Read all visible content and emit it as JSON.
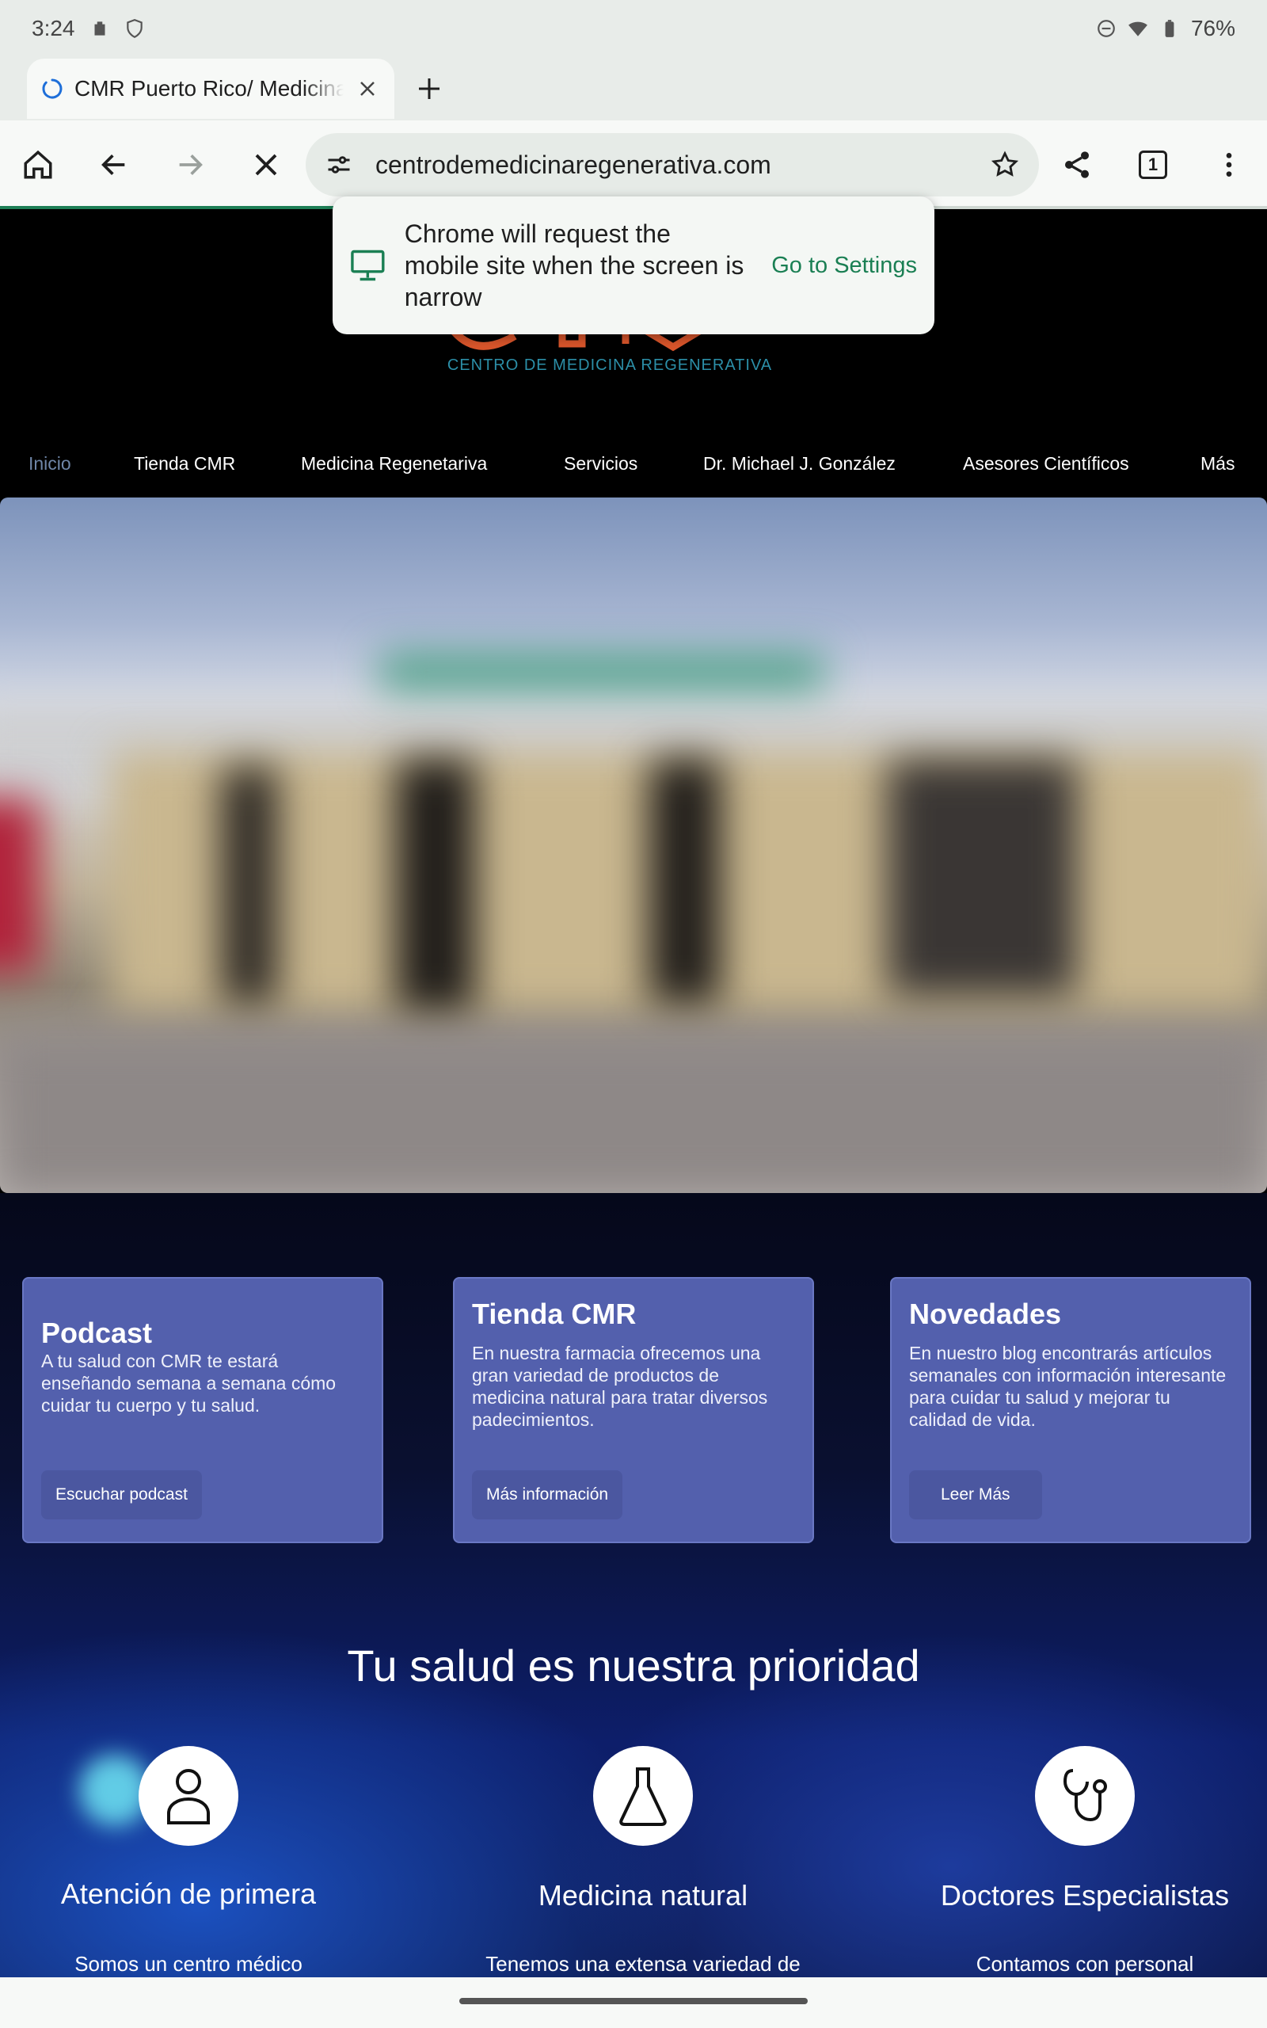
{
  "status_bar": {
    "time": "3:24",
    "battery": "76%"
  },
  "tab": {
    "title": "CMR Puerto Rico/ Medicina Regenerativa"
  },
  "toolbar": {
    "url": "centrodemedicinaregenerativa.com",
    "tab_count": "1",
    "load_progress": 0.45
  },
  "popup": {
    "message": "Chrome will request the mobile site when the screen is narrow",
    "action": "Go to Settings"
  },
  "site": {
    "logo_subtitle": "CENTRO DE MEDICINA REGENERATIVA",
    "nav": [
      "Inicio",
      "Tienda CMR",
      "Medicina Regenetariva",
      "Servicios",
      "Dr. Michael J. González",
      "Asesores Científicos",
      "Más"
    ],
    "cards": [
      {
        "title": "Podcast",
        "text": "A tu salud con CMR te estará enseñando semana a semana cómo cuidar tu cuerpo y tu salud.",
        "button": "Escuchar podcast"
      },
      {
        "title": "Tienda CMR",
        "text": "En nuestra farmacia ofrecemos una gran variedad de productos de medicina natural para tratar diversos padecimientos.",
        "button": "Más información"
      },
      {
        "title": "Novedades",
        "text": "En nuestro blog encontrarás artículos semanales con información interesante para cuidar tu salud y mejorar tu calidad de vida.",
        "button": "Leer Más"
      }
    ],
    "section_title": "Tu salud es nuestra prioridad",
    "features": [
      {
        "icon": "person-icon",
        "title": "Atención de primera",
        "text": "Somos un centro médico"
      },
      {
        "icon": "flask-icon",
        "title": "Medicina natural",
        "text": "Tenemos una extensa variedad de"
      },
      {
        "icon": "stethoscope-icon",
        "title": "Doctores Especialistas",
        "text": "Contamos con personal"
      }
    ]
  },
  "colors": {
    "accent_green": "#1a7f53",
    "card_bg": "#5360ad",
    "nav_active": "#6f86a8",
    "logo_teal": "#2c8fa8"
  }
}
